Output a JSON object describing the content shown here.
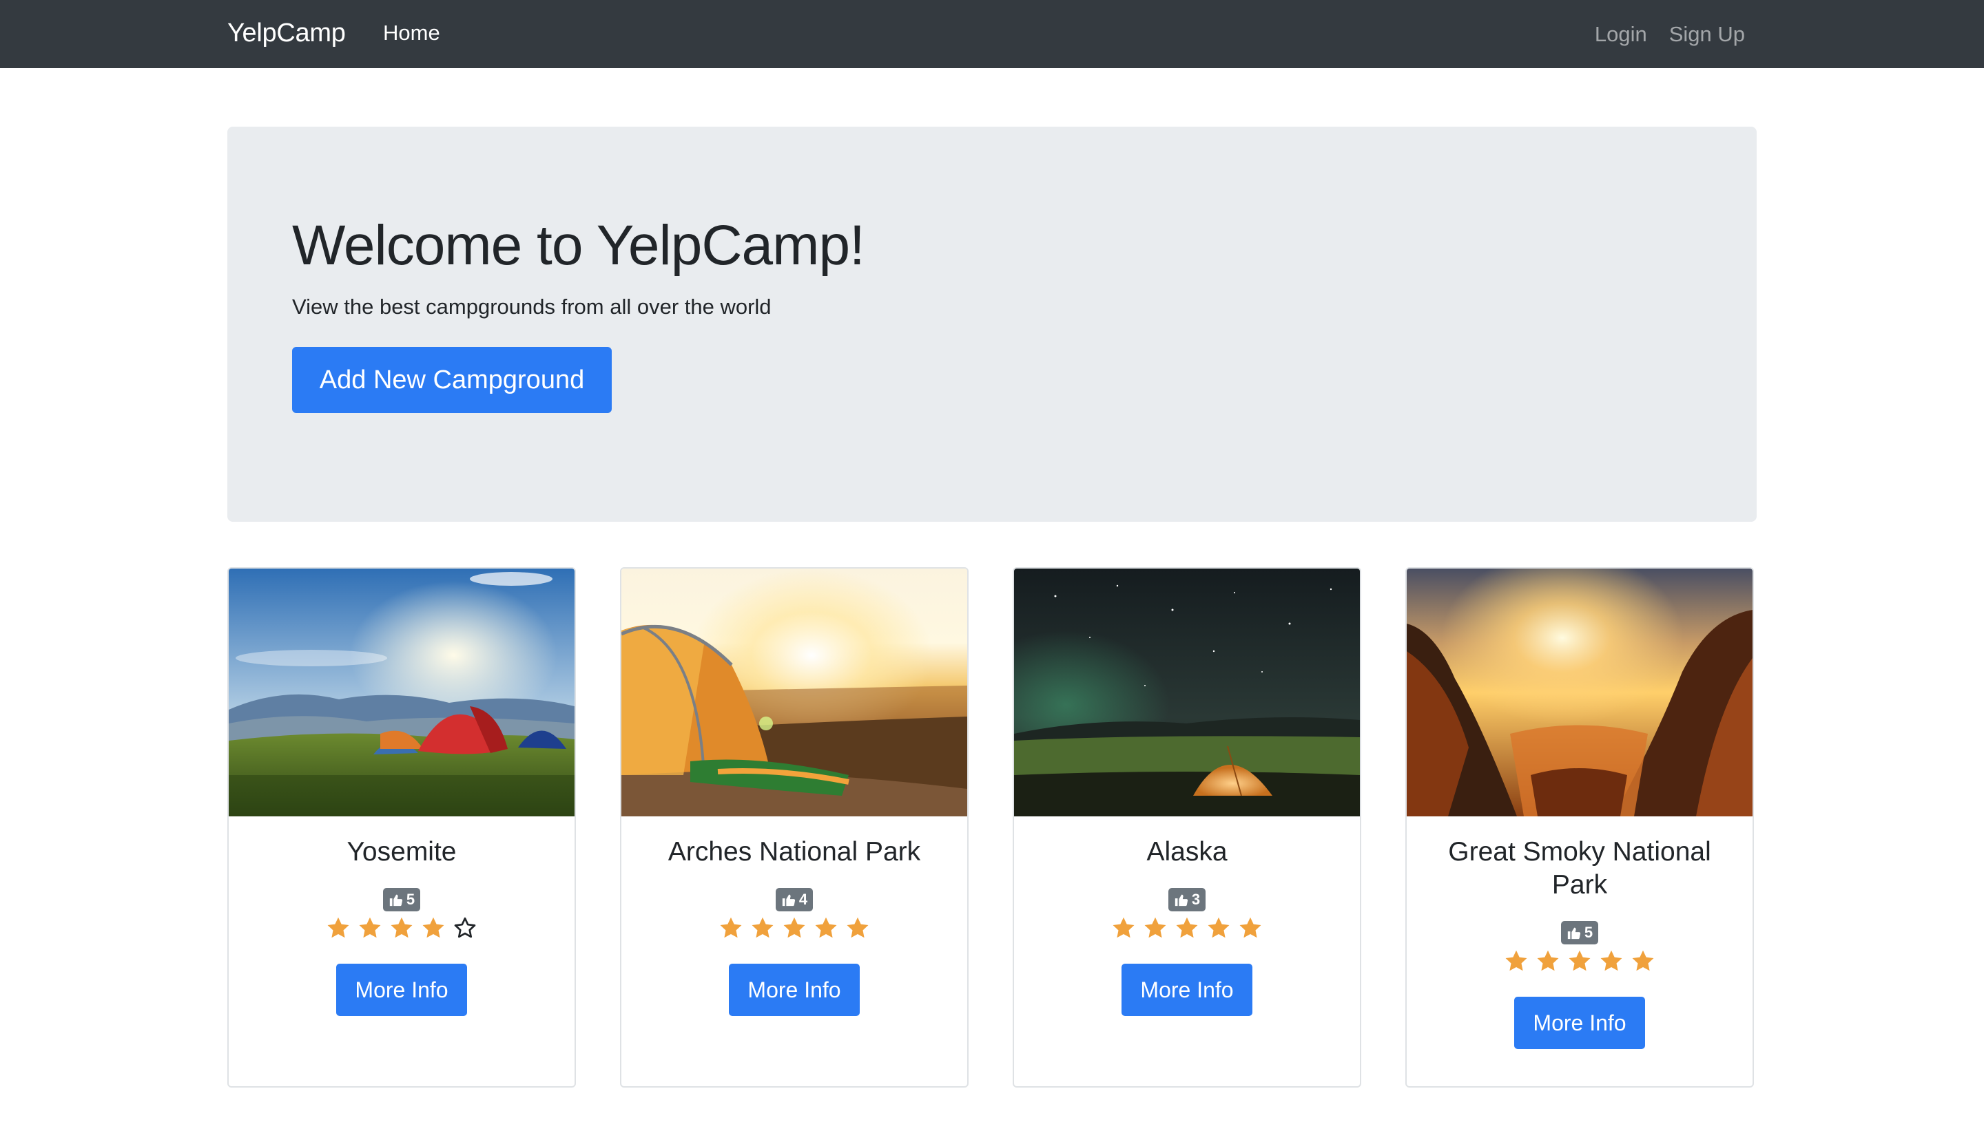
{
  "navbar": {
    "brand": "YelpCamp",
    "home": "Home",
    "login": "Login",
    "signup": "Sign Up"
  },
  "jumbotron": {
    "title": "Welcome to YelpCamp!",
    "subtitle": "View the best campgrounds from all over the world",
    "button": "Add New Campground"
  },
  "colors": {
    "navbar": "#343a40",
    "primary": "#2b7bf4",
    "jumbotron": "#e9ecef",
    "star": "#f0a13c",
    "badge": "#6c757d"
  },
  "campgrounds": [
    {
      "name": "Yosemite",
      "likes": "5",
      "rating": 4,
      "button": "More Info",
      "image": "tents-on-grassy-hill-at-sunrise"
    },
    {
      "name": "Arches National Park",
      "likes": "4",
      "rating": 5,
      "button": "More Info",
      "image": "tent-at-sunset-over-canyon"
    },
    {
      "name": "Alaska",
      "likes": "3",
      "rating": 5,
      "button": "More Info",
      "image": "tent-under-northern-lights"
    },
    {
      "name": "Great Smoky National Park",
      "likes": "5",
      "rating": 5,
      "button": "More Info",
      "image": "sunset-over-mountain-valley"
    }
  ]
}
